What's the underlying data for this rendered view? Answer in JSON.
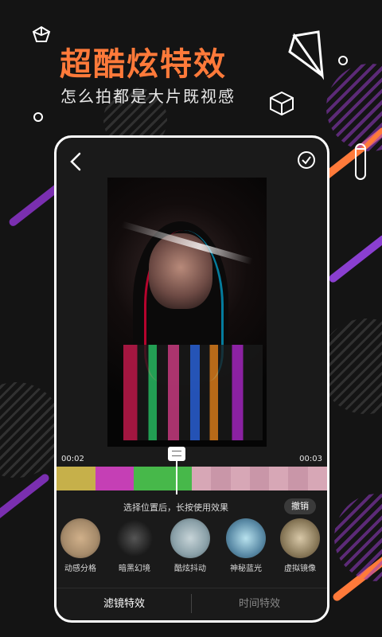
{
  "promo": {
    "title": "超酷炫特效",
    "subtitle": "怎么拍都是大片既视感"
  },
  "editor": {
    "time_start": "00:02",
    "time_end": "00:03",
    "hint": "选择位置后，长按使用效果",
    "undo_label": "撤销",
    "effects": [
      {
        "label": "动感分格",
        "tone": "#a58a6a"
      },
      {
        "label": "暗黑幻境",
        "tone": "#2a2a2a"
      },
      {
        "label": "酷炫抖动",
        "tone": "#8aa0a8"
      },
      {
        "label": "神秘蓝光",
        "tone": "#5a8aa6"
      },
      {
        "label": "虚拟镜像",
        "tone": "#8a7a5a"
      }
    ],
    "tabs": [
      {
        "label": "滤镜特效",
        "active": true
      },
      {
        "label": "时间特效",
        "active": false
      }
    ]
  },
  "colors": {
    "accent": "#ff7a3a",
    "background": "#141414"
  }
}
